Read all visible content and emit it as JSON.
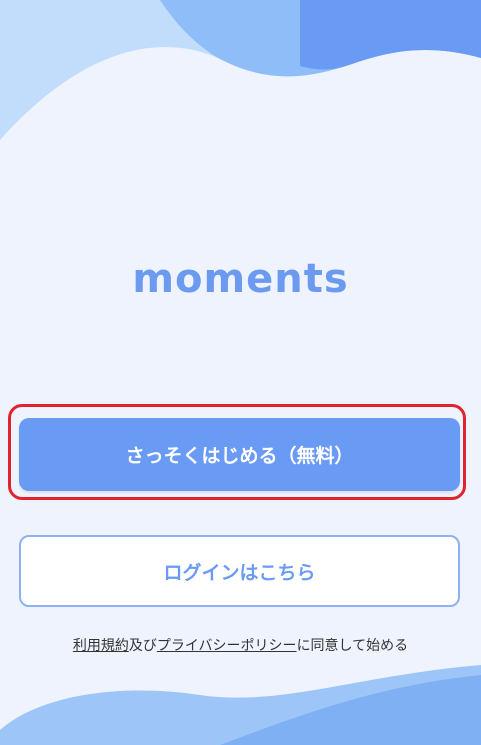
{
  "app": {
    "logo_text": "moments"
  },
  "actions": {
    "start_free_label": "さっそくはじめる（無料）",
    "login_label": "ログインはこちら"
  },
  "agreement": {
    "terms_link": "利用規約",
    "conjunction": "及び",
    "privacy_link": "プライバシーポリシー",
    "suffix": "に同意して始める"
  },
  "colors": {
    "accent": "#6a9bf4",
    "background": "#eef3fd",
    "highlight": "#e0242f"
  }
}
